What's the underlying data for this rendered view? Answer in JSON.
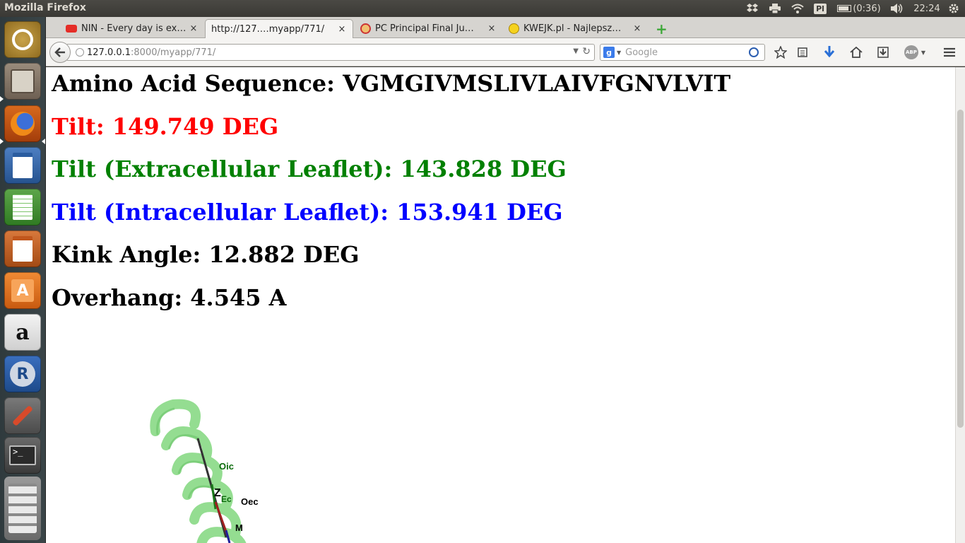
{
  "top_panel": {
    "window_title": "Mozilla Firefox",
    "keyboard_layout": "Pl",
    "battery_text": "(0:36)",
    "clock": "22:24",
    "icons": [
      "dropbox-icon",
      "printer-icon",
      "wifi-icon",
      "battery-icon",
      "volume-icon",
      "settings-gear-icon"
    ]
  },
  "launcher": {
    "items": [
      "ubuntu-dash",
      "files",
      "firefox",
      "libreoffice-writer",
      "libreoffice-calc",
      "libreoffice-impress",
      "ubuntu-software-center",
      "amazon",
      "r-language",
      "system-settings",
      "terminal",
      "workspace-switcher"
    ]
  },
  "tabs": [
    {
      "label": "NIN - Every day is ex…",
      "icon": "youtube-icon",
      "active": false
    },
    {
      "label": "http://127.…myapp/771/",
      "icon": "",
      "active": true
    },
    {
      "label": "PC Principal Final Ju…",
      "icon": "southpark-icon",
      "active": false
    },
    {
      "label": "KWEJK.pl - Najlepsz…",
      "icon": "smiley-icon",
      "active": false
    }
  ],
  "close_glyph": "×",
  "new_tab_glyph": "+",
  "navbar": {
    "url_host": "127.0.0.1",
    "url_path": ":8000/myapp/771/",
    "search_placeholder": "Google"
  },
  "page": {
    "sequence": "Amino Acid Sequence: VGMGIVMSLIVLAIVFGNVLVIT",
    "tilt": "Tilt: 149.749 DEG",
    "tilt_extracellular": "Tilt (Extracellular Leaflet): 143.828 DEG",
    "tilt_intracellular": "Tilt (Intracellular Leaflet): 153.941 DEG",
    "kink_angle": "Kink Angle: 12.882 DEG",
    "overhang": "Overhang: 4.545 A",
    "colors": {
      "default": "#000000",
      "tilt": "#ff0000",
      "extracellular": "#008000",
      "intracellular": "#0000ff"
    },
    "helix_labels": {
      "oic": "Oic",
      "z": "Z",
      "ec": "Ec",
      "oec": "Oec",
      "m": "M"
    }
  }
}
